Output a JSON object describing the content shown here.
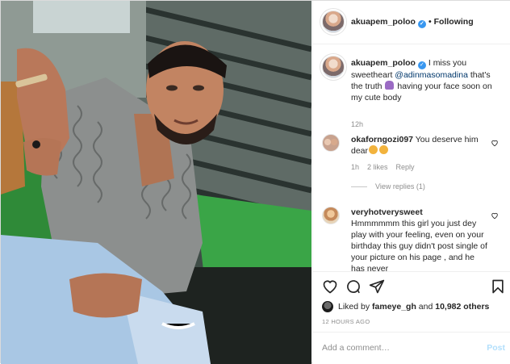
{
  "post": {
    "author": "akuapem_poloo",
    "separator": "•",
    "follow_status": "Following"
  },
  "caption": {
    "username": "akuapem_poloo",
    "text_before": " I miss you sweetheart ",
    "mention": "@adinmasomadina",
    "text_after": " that's the truth ",
    "text_end": " having your face soon on my cute body",
    "time": "12h"
  },
  "comments": [
    {
      "username": "okaforngozi097",
      "text": " You deserve him dear",
      "time": "1h",
      "likes": "2 likes",
      "reply_label": "Reply",
      "view_replies": "View replies (1)"
    },
    {
      "username": "veryhotverysweet",
      "text": "Hmmmmmm this girl you just dey play with your feeling, even on your birthday this guy didn't post single of your picture on his page , and he has never"
    }
  ],
  "likes": {
    "prefix": "Liked by ",
    "user": "fameye_gh",
    "middle": " and ",
    "others": "10,982 others"
  },
  "timestamp": "12 HOURS AGO",
  "add_comment": {
    "placeholder": "Add a comment…",
    "post_label": "Post"
  },
  "icons": {
    "verified": "verified-badge-icon",
    "heart": "heart-icon",
    "comment": "comment-icon",
    "share": "share-icon",
    "save": "bookmark-icon"
  },
  "colors": {
    "link": "#00376b",
    "verified": "#3897f0",
    "post_disabled": "#b2dffc",
    "muted": "#8e8e8e"
  }
}
